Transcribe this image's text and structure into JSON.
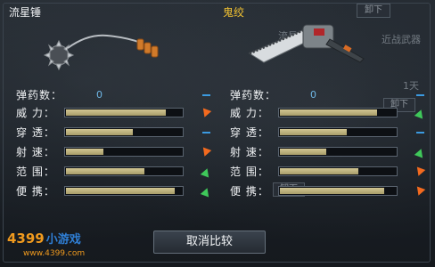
{
  "left": {
    "weapon_name": "流星锤",
    "weapon_icon": "meteor-hammer-icon",
    "ammo": {
      "label": "弹药数：",
      "value": "0",
      "indicator": "dash"
    },
    "stats": [
      {
        "label": "威  力：",
        "fill": 0.86,
        "indicator": "down"
      },
      {
        "label": "穿  透：",
        "fill": 0.58,
        "indicator": "dash"
      },
      {
        "label": "射  速：",
        "fill": 0.32,
        "indicator": "down"
      },
      {
        "label": "范  围：",
        "fill": 0.68,
        "indicator": "up"
      },
      {
        "label": "便  携：",
        "fill": 0.94,
        "indicator": "up"
      }
    ]
  },
  "right": {
    "weapon_name": "鬼绞",
    "weapon_icon": "chainsaw-icon",
    "ammo": {
      "label": "弹药数：",
      "value": "0",
      "indicator": "dash"
    },
    "stats": [
      {
        "label": "威  力：",
        "fill": 0.84,
        "indicator": "up"
      },
      {
        "label": "穿  透：",
        "fill": 0.58,
        "indicator": "dash"
      },
      {
        "label": "射  速：",
        "fill": 0.4,
        "indicator": "up"
      },
      {
        "label": "范  围：",
        "fill": 0.68,
        "indicator": "down"
      },
      {
        "label": "便  携：",
        "fill": 0.9,
        "indicator": "down"
      }
    ]
  },
  "background": {
    "tab_unload_1": "卸下",
    "tab_unload_2": "卸下",
    "melee_label": "近战武器",
    "weapon_ghost": "流星锤",
    "days": "1天",
    "unload_bottom": "卸下"
  },
  "cancel_button": "取消比较",
  "logo": {
    "text": "4399",
    "sub": "小游戏",
    "url": "www.4399.com"
  },
  "colors": {
    "up": "#3fc85a",
    "down": "#f36a1f",
    "dash": "#3b9ae0",
    "bar": "#c9bd86"
  }
}
